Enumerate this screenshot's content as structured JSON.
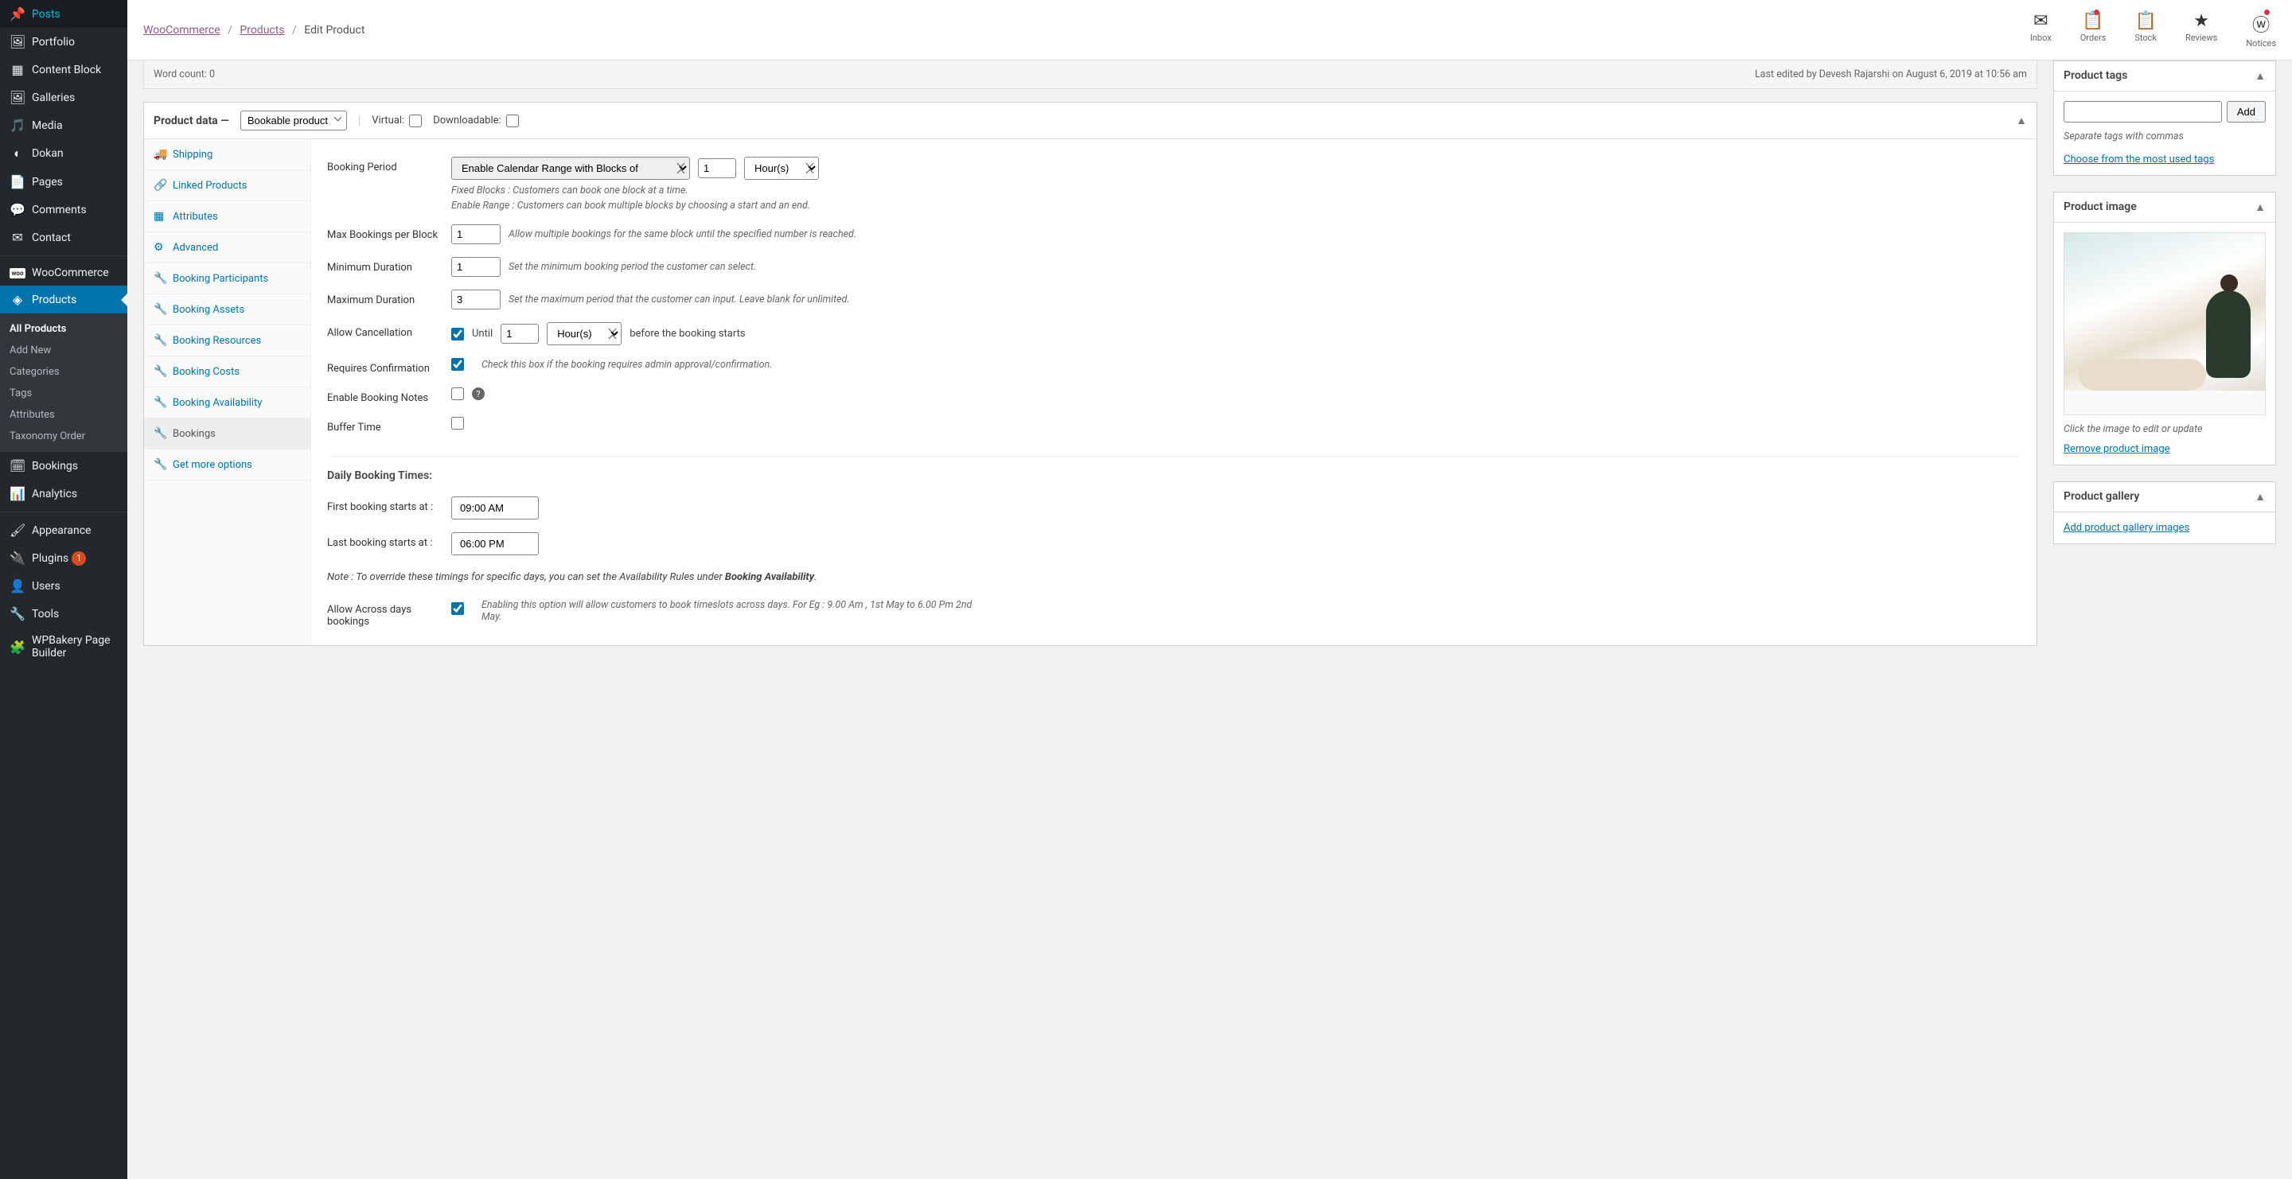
{
  "sidebar": {
    "items": [
      {
        "icon": "📌",
        "label": "Posts"
      },
      {
        "icon": "🖼",
        "label": "Portfolio"
      },
      {
        "icon": "▦",
        "label": "Content Block"
      },
      {
        "icon": "🖼",
        "label": "Galleries"
      },
      {
        "icon": "🎵",
        "label": "Media"
      },
      {
        "icon": "◐",
        "label": "Dokan"
      },
      {
        "icon": "📄",
        "label": "Pages"
      },
      {
        "icon": "💬",
        "label": "Comments"
      },
      {
        "icon": "✉",
        "label": "Contact"
      }
    ],
    "woo": {
      "icon": "woo",
      "label": "WooCommerce"
    },
    "products": {
      "icon": "📦",
      "label": "Products"
    },
    "submenu": [
      {
        "label": "All Products"
      },
      {
        "label": "Add New"
      },
      {
        "label": "Categories"
      },
      {
        "label": "Tags"
      },
      {
        "label": "Attributes"
      },
      {
        "label": "Taxonomy Order"
      }
    ],
    "rest": [
      {
        "icon": "🗓",
        "label": "Bookings"
      },
      {
        "icon": "📊",
        "label": "Analytics"
      }
    ],
    "bottom": [
      {
        "icon": "🖌",
        "label": "Appearance"
      },
      {
        "icon": "🔌",
        "label": "Plugins",
        "badge": "1"
      },
      {
        "icon": "👤",
        "label": "Users"
      },
      {
        "icon": "🔧",
        "label": "Tools"
      },
      {
        "icon": "🧩",
        "label": "WPBakery Page Builder"
      }
    ]
  },
  "breadcrumb": {
    "a": "WooCommerce",
    "b": "Products",
    "c": "Edit Product"
  },
  "top_icons": [
    {
      "icon": "✉",
      "label": "Inbox",
      "dot": false
    },
    {
      "icon": "📋",
      "label": "Orders",
      "dot": true
    },
    {
      "icon": "📋",
      "label": "Stock",
      "dot": false
    },
    {
      "icon": "★",
      "label": "Reviews",
      "dot": false
    },
    {
      "icon": "ⓦ",
      "label": "Notices",
      "dot": true
    }
  ],
  "wordcount": {
    "left": "Word count: 0",
    "right": "Last edited by Devesh Rajarshi on August 6, 2019 at 10:56 am"
  },
  "product_data": {
    "title": "Product data —",
    "type": "Bookable product",
    "virtual": "Virtual:",
    "downloadable": "Downloadable:"
  },
  "tabs": [
    {
      "icon": "🚚",
      "label": "Shipping"
    },
    {
      "icon": "🔗",
      "label": "Linked Products"
    },
    {
      "icon": "▦",
      "label": "Attributes"
    },
    {
      "icon": "⚙",
      "label": "Advanced"
    },
    {
      "icon": "🔧",
      "label": "Booking Participants"
    },
    {
      "icon": "🔧",
      "label": "Booking Assets"
    },
    {
      "icon": "🔧",
      "label": "Booking Resources"
    },
    {
      "icon": "🔧",
      "label": "Booking Costs"
    },
    {
      "icon": "🔧",
      "label": "Booking Availability"
    },
    {
      "icon": "🔧",
      "label": "Bookings",
      "active": true
    },
    {
      "icon": "🔧",
      "label": "Get more options"
    }
  ],
  "fields": {
    "booking_period": {
      "label": "Booking Period",
      "select": "Enable Calendar Range with Blocks of",
      "value": "1",
      "unit": "Hour(s)",
      "help1": "Fixed Blocks : Customers can book one block at a time.",
      "help2": "Enable Range : Customers can book multiple blocks by choosing a start and an end."
    },
    "max_bookings": {
      "label": "Max Bookings per Block",
      "value": "1",
      "help": "Allow multiple bookings for the same block until the specified number is reached."
    },
    "min_duration": {
      "label": "Minimum Duration",
      "value": "1",
      "help": "Set the minimum booking period the customer can select."
    },
    "max_duration": {
      "label": "Maximum Duration",
      "value": "3",
      "help": "Set the maximum period that the customer can input. Leave blank for unlimited."
    },
    "allow_cancel": {
      "label": "Allow Cancellation",
      "checked": true,
      "until": "Until",
      "value": "1",
      "unit": "Hour(s)",
      "after": "before the booking starts"
    },
    "requires_conf": {
      "label": "Requires Confirmation",
      "checked": true,
      "help": "Check this box if the booking requires admin approval/confirmation."
    },
    "enable_notes": {
      "label": "Enable Booking Notes",
      "checked": false
    },
    "buffer_time": {
      "label": "Buffer Time",
      "checked": false
    },
    "daily_title": "Daily Booking Times:",
    "first_booking": {
      "label": "First booking starts at :",
      "value": "09:00 AM"
    },
    "last_booking": {
      "label": "Last booking starts at :",
      "value": "06:00 PM"
    },
    "note_text": "Note : To override these timings for specific days, you can set the Availability Rules under ",
    "note_bold": "Booking Availability",
    "allow_across": {
      "label": "Allow Across days bookings",
      "checked": true,
      "help": "Enabling this option will allow customers to book timeslots across days. For Eg : 9.00 Am , 1st May to 6.00 Pm 2nd May."
    }
  },
  "tags_panel": {
    "title": "Product tags",
    "add": "Add",
    "hint": "Separate tags with commas",
    "link": "Choose from the most used tags"
  },
  "image_panel": {
    "title": "Product image",
    "hint": "Click the image to edit or update",
    "remove": "Remove product image"
  },
  "gallery_panel": {
    "title": "Product gallery",
    "link": "Add product gallery images"
  }
}
